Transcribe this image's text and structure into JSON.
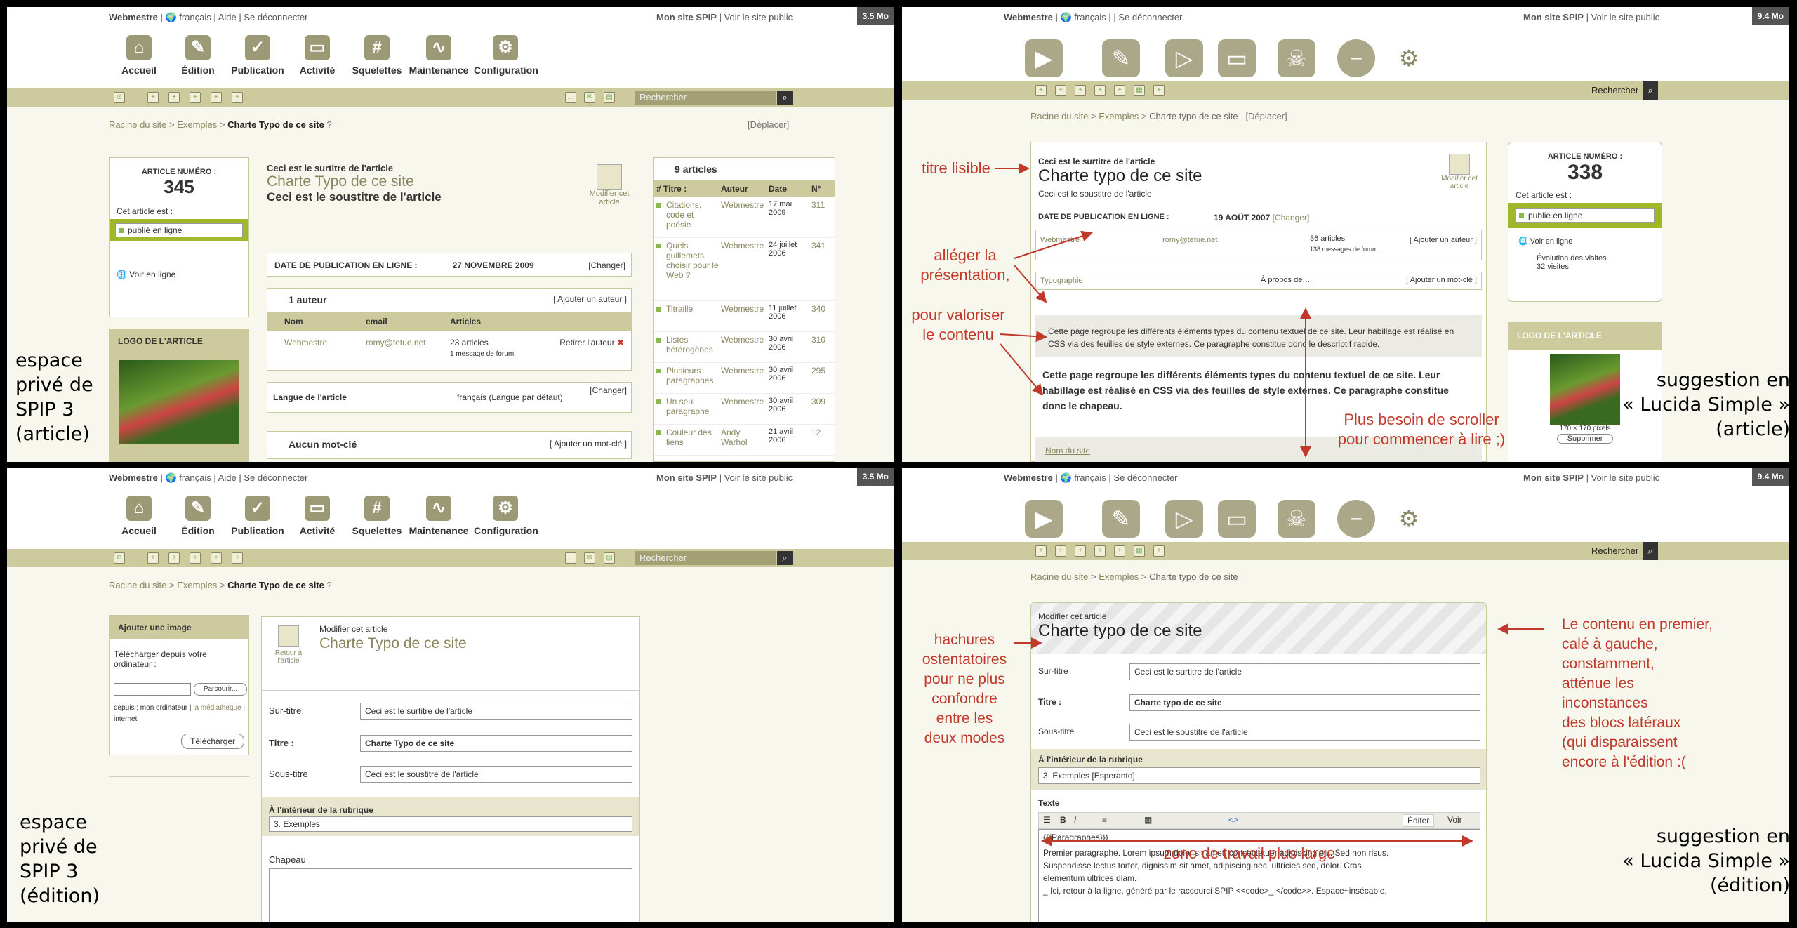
{
  "common": {
    "user": "Webmestre",
    "sep": "|",
    "lang": "français",
    "help": "Aide",
    "logout": "Se déconnecter",
    "site": "Mon site SPIP",
    "public": "Voir le site public",
    "size1": "3.5 Mo",
    "size2": "9.4 Mo",
    "search_placeholder": "Rechercher",
    "search_label": "Rechercher",
    "nav": [
      "Accueil",
      "Édition",
      "Publication",
      "Activité",
      "Squelettes",
      "Maintenance",
      "Configuration"
    ]
  },
  "q1": {
    "crumb_root": "Racine du site",
    "crumb_mid": "Exemples",
    "crumb_cur": "Charte Typo de ce site",
    "move": "[Déplacer]",
    "art_num_label": "ARTICLE NUMÉRO :",
    "art_num": "345",
    "status_label": "Cet article est :",
    "status": "publié en ligne",
    "view_online": "Voir en ligne",
    "logo_label": "LOGO DE L'ARTICLE",
    "surtitre": "Ceci est le surtitre de l'article",
    "titre": "Charte Typo de ce site",
    "soustitre": "Ceci est le soustitre de l'article",
    "modify": "Modifier cet article",
    "date_label": "DATE DE PUBLICATION EN LIGNE :",
    "date": "27 NOVEMBRE 2009",
    "change": "[Changer]",
    "author_count": "1 auteur",
    "add_author": "[ Ajouter un auteur ]",
    "col_nom": "Nom",
    "col_email": "email",
    "col_articles": "Articles",
    "author": "Webmestre",
    "email": "romy@tetue.net",
    "articles": "23 articles",
    "forum": "1 message de forum",
    "remove": "Retirer l'auteur",
    "lang_label": "Langue de l'article",
    "lang_val": "français (Langue par défaut)",
    "nokw": "Aucun mot-clé",
    "addkw": "[ Ajouter un mot-clé ]",
    "list_title": "9 articles",
    "list_cols": [
      "# Titre :",
      "Auteur",
      "Date",
      "N°"
    ],
    "list": [
      [
        "Citations, code et poésie",
        "Webmestre",
        "17 mai 2009",
        "311"
      ],
      [
        "Quels guillemets choisir pour le Web ?",
        "Webmestre",
        "24 juillet 2006",
        "341"
      ],
      [
        "Titraille",
        "Webmestre",
        "11 juillet 2006",
        "340"
      ],
      [
        "Listes hétérogènes",
        "Webmestre",
        "30 avril 2006",
        "310"
      ],
      [
        "Plusieurs paragraphes",
        "Webmestre",
        "30 avril 2006",
        "295"
      ],
      [
        "Un seul paragraphe",
        "Webmestre",
        "30 avril 2006",
        "309"
      ],
      [
        "Couleur des liens",
        "Andy Warhol",
        "21 avril 2006",
        "12"
      ]
    ],
    "caption": [
      "espace",
      "privé de",
      "SPIP 3",
      "(article)"
    ]
  },
  "q2": {
    "crumb_root": "Racine du site",
    "crumb_mid": "Exemples",
    "crumb_cur": "Charte typo de ce site",
    "move": "[Déplacer]",
    "surtitre": "Ceci est le surtitre de l'article",
    "titre": "Charte typo de ce site",
    "soustitre": "Ceci est le soustitre de l'article",
    "modify": "Modifier cet article",
    "date_label": "DATE DE PUBLICATION EN LIGNE :",
    "date": "19 AOÛT 2007",
    "change": "[Changer]",
    "author": "Webmestre",
    "email": "romy@tetue.net",
    "articles": "36 articles",
    "forum": "138 messages de forum",
    "add_author": "[ Ajouter un auteur ]",
    "kw": "Typographie",
    "kw_group": "À propos de…",
    "add_kw": "[ Ajouter un mot-clé ]",
    "desc": "Cette page regroupe les différents éléments types du contenu textuel de ce site. Leur habillage est réalisé en CSS via des feuilles de style externes. Ce paragraphe constitue donc le descriptif rapide.",
    "chapo": "Cette page regroupe les différents éléments types du contenu textuel de ce site. Leur habillage est réalisé en CSS via des feuilles de style externes. Ce paragraphe constitue donc le chapeau.",
    "site_name": "Nom du site",
    "art_num_label": "ARTICLE NUMÉRO :",
    "art_num": "338",
    "status_label": "Cet article est :",
    "status": "publié en ligne",
    "view_online": "Voir en ligne",
    "stats": "Évolution des visites",
    "visits": "32 visites",
    "logo_label": "LOGO DE L'ARTICLE",
    "logo_size": "170 × 170 pixels",
    "delete": "Supprimer",
    "ann": {
      "a1": "titre lisible",
      "a2": [
        "alléger la",
        "présentation,"
      ],
      "a3": [
        "pour valoriser",
        "le contenu"
      ],
      "a4": [
        "Plus besoin de scroller",
        "pour commencer à lire ;)"
      ]
    },
    "caption": [
      "suggestion en",
      "« Lucida Simple »",
      "(article)"
    ]
  },
  "q3": {
    "crumb_root": "Racine du site",
    "crumb_mid": "Exemples",
    "crumb_cur": "Charte Typo de ce site",
    "img_title": "Ajouter une image",
    "upload_label": "Télécharger depuis votre ordinateur :",
    "browse": "Parcourir...",
    "from": "depuis : mon ordinateur",
    "from_lib": "la médiathèque",
    "from_net": "internet",
    "upload": "Télécharger",
    "back": "Retour à l'article",
    "edit_label": "Modifier cet article",
    "titre_head": "Charte Typo de ce site",
    "surtitre_label": "Sur-titre",
    "surtitre": "Ceci est le surtitre de l'article",
    "titre_label": "Titre :",
    "titre": "Charte Typo de ce site",
    "soustitre_label": "Sous-titre",
    "soustitre": "Ceci est le soustitre de l'article",
    "rub_label": "À l'intérieur de la rubrique",
    "rub": "3. Exemples",
    "chapo_label": "Chapeau",
    "caption": [
      "espace",
      "privé de",
      "SPIP 3",
      "(édition)"
    ]
  },
  "q4": {
    "crumb_root": "Racine du site",
    "crumb_mid": "Exemples",
    "crumb_cur": "Charte typo de ce site",
    "edit_label": "Modifier cet article",
    "titre_head": "Charte typo de ce site",
    "surtitre_label": "Sur-titre",
    "surtitre": "Ceci est le surtitre de l'article",
    "titre_label": "Titre :",
    "titre": "Charte typo de ce site",
    "soustitre_label": "Sous-titre",
    "soustitre": "Ceci est le soustitre de l'article",
    "rub_label": "À l'intérieur de la rubrique",
    "rub": "3. Exemples [Esperanto]",
    "texte_label": "Texte",
    "tab_edit": "Éditer",
    "tab_view": "Voir",
    "text_lines": [
      "{{{Paragraphes}}}",
      "Premier paragraphe. Lorem ipsum dolor sit amet, consectetuer adipiscing elit. Sed non risus.",
      "Suspendisse lectus tortor, dignissim sit amet, adipiscing nec, ultricies sed, dolor. Cras",
      "elementum ultrices diam.",
      "_ Ici, retour à la ligne, généré par le raccourci SPIP <<code>_ </code>>. Espace~insécable."
    ],
    "ann": {
      "a1": [
        "hachures",
        "ostentatoires",
        "pour ne plus",
        "confondre",
        "entre les",
        "deux modes"
      ],
      "a2": [
        "Le contenu en premier,",
        "calé à gauche,",
        "constamment,",
        "atténue les",
        "inconstances",
        "des blocs latéraux",
        "(qui disparaissent",
        "encore à l'édition :("
      ],
      "a3": "zone de travail plus large"
    },
    "caption": [
      "suggestion en",
      "« Lucida Simple »",
      "(édition)"
    ]
  }
}
